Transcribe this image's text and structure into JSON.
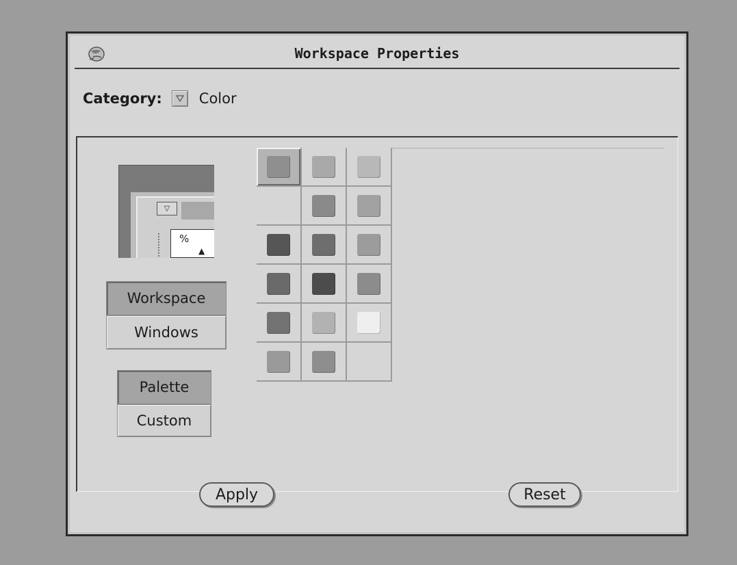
{
  "window": {
    "title": "Workspace Properties",
    "title_icon": "globe-icon"
  },
  "category": {
    "label": "Category:",
    "menu_icon": "chevron-down-icon",
    "value": "Color"
  },
  "preview": {
    "button_glyph": "▽",
    "field_text": "%",
    "field_glyph": "▲"
  },
  "target_buttons": [
    {
      "label": "Workspace",
      "selected": true
    },
    {
      "label": "Windows",
      "selected": false
    }
  ],
  "mode_buttons": [
    {
      "label": "Palette",
      "selected": true
    },
    {
      "label": "Custom",
      "selected": false
    }
  ],
  "palette": {
    "columns": 3,
    "swatches": [
      {
        "color": "#8f8f8f",
        "selected": true
      },
      {
        "color": "#a9a9a9",
        "selected": false
      },
      {
        "color": "#b8b8b8",
        "selected": false
      },
      {
        "color": null,
        "selected": false
      },
      {
        "color": "#8a8a8a",
        "selected": false
      },
      {
        "color": "#a2a2a2",
        "selected": false
      },
      {
        "color": "#565656",
        "selected": false
      },
      {
        "color": "#6e6e6e",
        "selected": false
      },
      {
        "color": "#9c9c9c",
        "selected": false
      },
      {
        "color": "#6a6a6a",
        "selected": false
      },
      {
        "color": "#4c4c4c",
        "selected": false
      },
      {
        "color": "#8c8c8c",
        "selected": false
      },
      {
        "color": "#727272",
        "selected": false
      },
      {
        "color": "#b2b2b2",
        "selected": false
      },
      {
        "color": "#efefef",
        "selected": false
      },
      {
        "color": "#9a9a9a",
        "selected": false
      },
      {
        "color": "#8e8e8e",
        "selected": false
      },
      {
        "color": null,
        "selected": false
      }
    ]
  },
  "footer": {
    "apply_label": "Apply",
    "reset_label": "Reset"
  }
}
